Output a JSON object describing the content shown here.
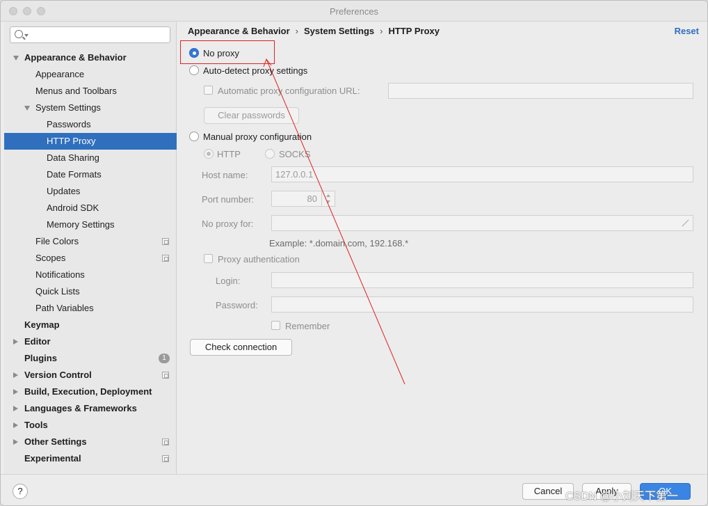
{
  "window": {
    "title": "Preferences"
  },
  "search": {
    "placeholder": ""
  },
  "sidebar": {
    "items": [
      {
        "label": "Appearance & Behavior",
        "level": 0,
        "bold": true,
        "expanded": true
      },
      {
        "label": "Appearance",
        "level": 1
      },
      {
        "label": "Menus and Toolbars",
        "level": 1
      },
      {
        "label": "System Settings",
        "level": 1,
        "expanded": true
      },
      {
        "label": "Passwords",
        "level": 2
      },
      {
        "label": "HTTP Proxy",
        "level": 2,
        "selected": true
      },
      {
        "label": "Data Sharing",
        "level": 2
      },
      {
        "label": "Date Formats",
        "level": 2
      },
      {
        "label": "Updates",
        "level": 2
      },
      {
        "label": "Android SDK",
        "level": 2
      },
      {
        "label": "Memory Settings",
        "level": 2
      },
      {
        "label": "File Colors",
        "level": 1,
        "project_icon": true
      },
      {
        "label": "Scopes",
        "level": 1,
        "project_icon": true
      },
      {
        "label": "Notifications",
        "level": 1
      },
      {
        "label": "Quick Lists",
        "level": 1
      },
      {
        "label": "Path Variables",
        "level": 1
      },
      {
        "label": "Keymap",
        "level": 0,
        "bold": true
      },
      {
        "label": "Editor",
        "level": 0,
        "bold": true,
        "collapsed": true
      },
      {
        "label": "Plugins",
        "level": 0,
        "bold": true,
        "badge": "1"
      },
      {
        "label": "Version Control",
        "level": 0,
        "bold": true,
        "collapsed": true,
        "project_icon": true
      },
      {
        "label": "Build, Execution, Deployment",
        "level": 0,
        "bold": true,
        "collapsed": true
      },
      {
        "label": "Languages & Frameworks",
        "level": 0,
        "bold": true,
        "collapsed": true
      },
      {
        "label": "Tools",
        "level": 0,
        "bold": true,
        "collapsed": true
      },
      {
        "label": "Other Settings",
        "level": 0,
        "bold": true,
        "collapsed": true,
        "project_icon": true
      },
      {
        "label": "Experimental",
        "level": 0,
        "bold": true,
        "project_icon": true
      }
    ]
  },
  "breadcrumb": {
    "part1": "Appearance & Behavior",
    "part2": "System Settings",
    "part3": "HTTP Proxy"
  },
  "reset_label": "Reset",
  "proxy": {
    "no_proxy": "No proxy",
    "auto_detect": "Auto-detect proxy settings",
    "auto_url_label": "Automatic proxy configuration URL:",
    "auto_url_value": "",
    "clear_passwords": "Clear passwords",
    "manual": "Manual proxy configuration",
    "http": "HTTP",
    "socks": "SOCKS",
    "host_label": "Host name:",
    "host_value": "127.0.0.1",
    "port_label": "Port number:",
    "port_value": "80",
    "no_proxy_for_label": "No proxy for:",
    "no_proxy_for_value": "",
    "example": "Example: *.domain.com, 192.168.*",
    "proxy_auth": "Proxy authentication",
    "login_label": "Login:",
    "login_value": "",
    "password_label": "Password:",
    "password_value": "",
    "remember": "Remember",
    "check_connection": "Check connection",
    "selected_mode": "no_proxy"
  },
  "footer": {
    "help": "?",
    "cancel": "Cancel",
    "apply": "Apply",
    "ok": "OK",
    "watermark": "CSDN @小刘天下第一"
  },
  "colors": {
    "selection": "#2f6fbe",
    "accent": "#3478d4",
    "annotation": "#e02020"
  }
}
